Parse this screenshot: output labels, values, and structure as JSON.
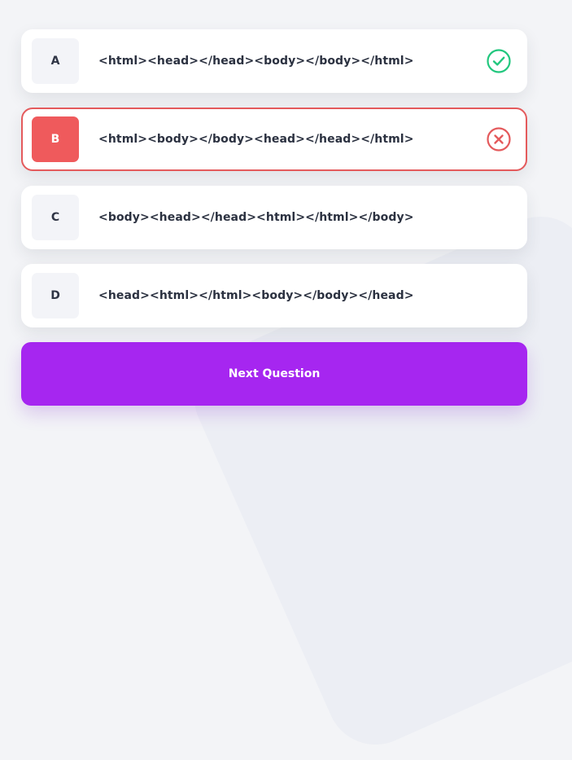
{
  "options": [
    {
      "letter": "A",
      "text": "<html><head></head><body></body></html>",
      "state": "correct",
      "icon": "check-circle-icon"
    },
    {
      "letter": "B",
      "text": "<html><body></body><head></head></html>",
      "state": "wrong",
      "icon": "x-circle-icon"
    },
    {
      "letter": "C",
      "text": "<body><head></head><html></html></body>",
      "state": "neutral"
    },
    {
      "letter": "D",
      "text": "<head><html></html><body></body></head>",
      "state": "neutral"
    }
  ],
  "next_button": {
    "label": "Next Question"
  },
  "colors": {
    "correct": "#22c77e",
    "wrong": "#e45a5c",
    "accent": "#a626f0",
    "background": "#f3f4f7"
  }
}
